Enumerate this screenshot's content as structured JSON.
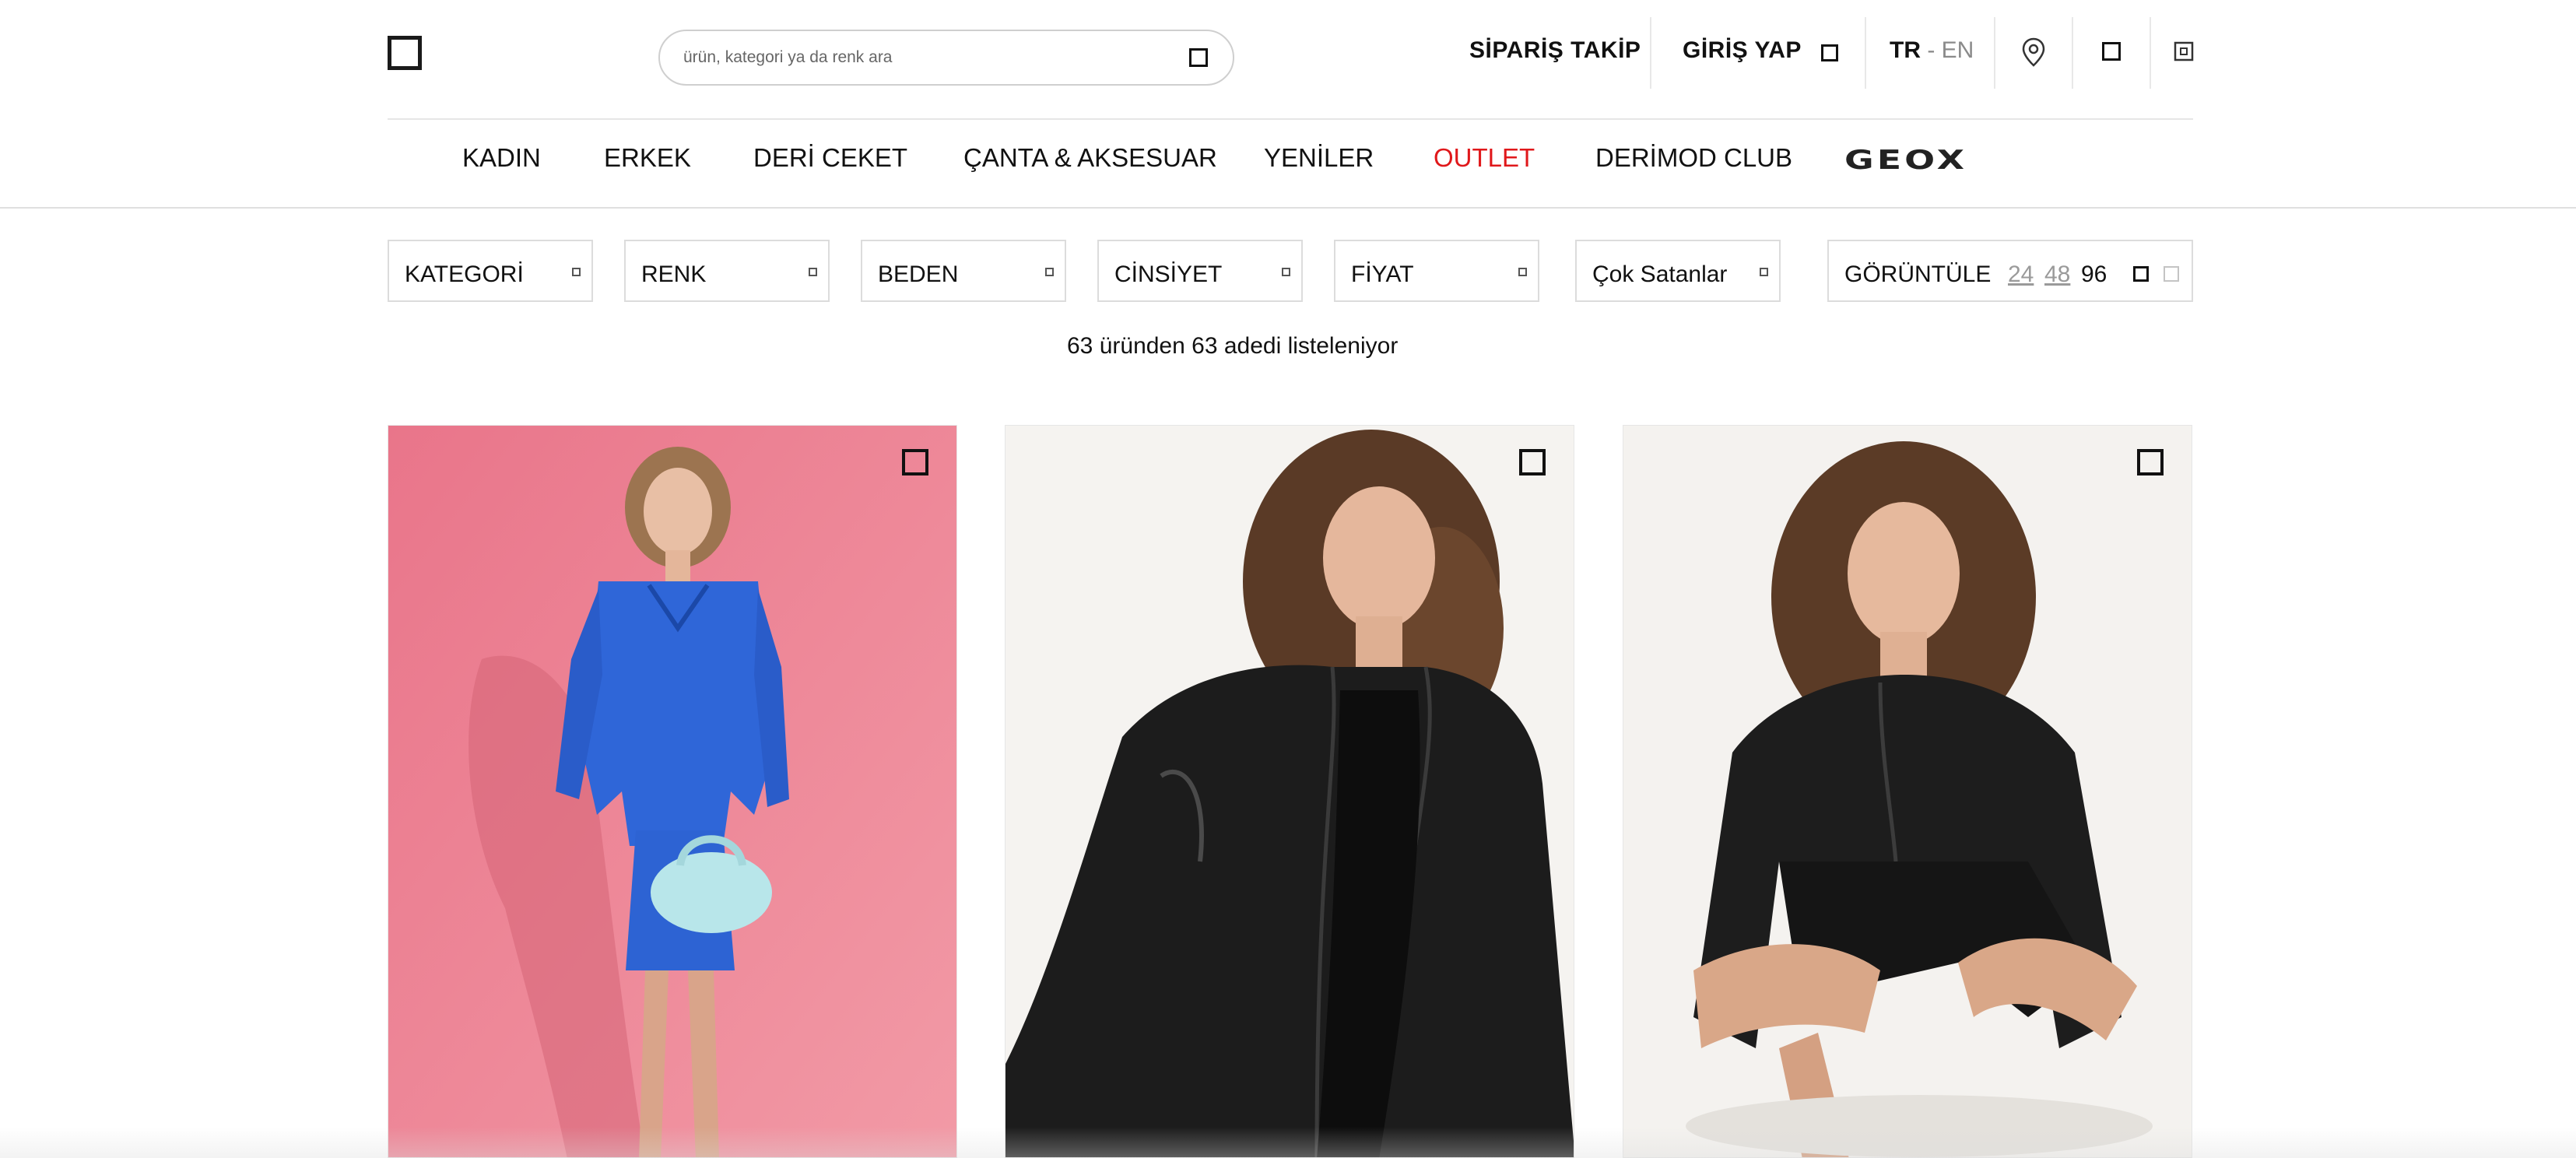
{
  "header": {
    "search": {
      "placeholder": "ürün, kategori ya da renk ara",
      "value": ""
    },
    "order_tracking": "SİPARİŞ TAKİP",
    "login": "GİRİŞ YAP",
    "language": {
      "active": "TR",
      "separator": " - ",
      "other": "EN"
    },
    "icons": [
      "logo-icon",
      "search-icon",
      "user-icon",
      "location-pin-icon",
      "favorites-icon",
      "cart-icon"
    ]
  },
  "nav": {
    "items": [
      {
        "label": "KADIN"
      },
      {
        "label": "ERKEK"
      },
      {
        "label": "DERİ CEKET"
      },
      {
        "label": "ÇANTA & AKSESUAR"
      },
      {
        "label": "YENİLER"
      },
      {
        "label": "OUTLET",
        "color": "#e0181b"
      },
      {
        "label": "DERİMOD CLUB"
      }
    ],
    "brand_logo": "GEOX"
  },
  "filters": {
    "items": [
      {
        "label": "KATEGORİ"
      },
      {
        "label": "RENK"
      },
      {
        "label": "BEDEN"
      },
      {
        "label": "CİNSİYET"
      },
      {
        "label": "FİYAT"
      }
    ],
    "sort": {
      "selected": "Çok Satanlar"
    },
    "view": {
      "label": "GÖRÜNTÜLE",
      "options": [
        "24",
        "48",
        "96"
      ],
      "selected": "96"
    }
  },
  "results": {
    "text": "63 üründen 63 adedi listeleniyor"
  },
  "products": [
    {
      "image_desc": "model-blue-leather-jacket",
      "background": "#ec8a97"
    },
    {
      "image_desc": "model-black-leather-jacket-standing",
      "background": "#f5f3f0"
    },
    {
      "image_desc": "model-black-leather-jacket-seated",
      "background": "#f4f2ef"
    }
  ],
  "colors": {
    "accent_sale": "#e0181b",
    "text": "#111111",
    "border": "#dcdcdc"
  }
}
